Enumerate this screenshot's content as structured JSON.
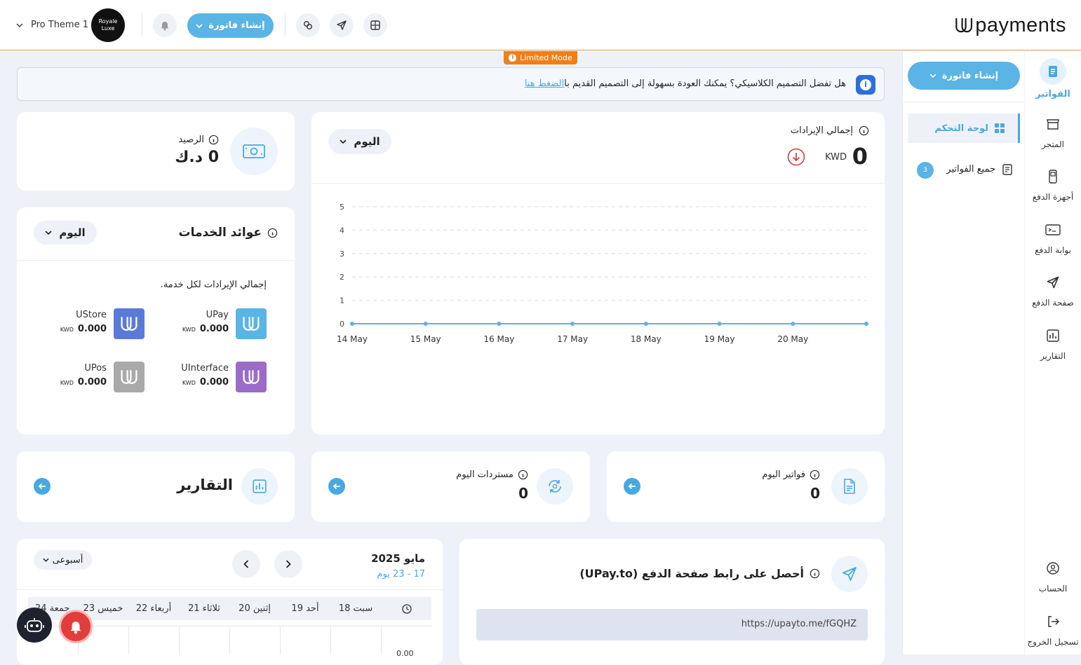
{
  "header": {
    "brand": "payments",
    "user_name": "Pro Theme 1",
    "avatar_text": [
      "Royale",
      "Luxe"
    ],
    "create_invoice_label": "إنشاء فاتورة"
  },
  "limited_mode": "Limited Mode",
  "banner": {
    "text": "هل تفضل التصميم الكلاسيكي؟ يمكنك العودة بسهولة إلى التصميم القديم با",
    "link": "الضغط هنا"
  },
  "rail": {
    "items": [
      {
        "label": "الفواتير",
        "icon": "invoice-icon",
        "active": true
      },
      {
        "label": "المتجر",
        "icon": "store-icon"
      },
      {
        "label": "أجهزة الدفع",
        "icon": "pos-device-icon"
      },
      {
        "label": "بوابة الدفع",
        "icon": "payment-gateway-icon"
      },
      {
        "label": "صفحة الدفع",
        "icon": "send-icon"
      },
      {
        "label": "التقارير",
        "icon": "reports-icon"
      }
    ],
    "account": "الحساب",
    "logout": "تسجيل الخروج"
  },
  "subpanel": {
    "create_invoice_label": "إنشاء فاتورة",
    "dashboard": "لوحة التحكم",
    "all_invoices": "جميع الفواتير",
    "all_invoices_count": "3"
  },
  "revenue": {
    "title": "إجمالي الإيرادات",
    "value": "0",
    "currency": "KWD",
    "period": "اليوم"
  },
  "chart_data": {
    "type": "line",
    "categories": [
      "14 May",
      "15 May",
      "16 May",
      "17 May",
      "18 May",
      "19 May",
      "20 May",
      ""
    ],
    "values": [
      0,
      0,
      0,
      0,
      0,
      0,
      0,
      0
    ],
    "y_ticks": [
      "0",
      "1",
      "2",
      "3",
      "4",
      "5"
    ],
    "ylim": [
      0,
      5
    ],
    "grid": true,
    "color": "#5ab4e5"
  },
  "balance": {
    "title": "الرصيد",
    "value": "0 د.ك"
  },
  "services": {
    "title": "عوائد الخدمات",
    "period": "اليوم",
    "subtitle": "إجمالي الإيرادات لكل خدمة.",
    "items": [
      {
        "name": "UPay",
        "value": "0.000",
        "unit": "KWD",
        "color": "#5ab4e5"
      },
      {
        "name": "UStore",
        "value": "0.000",
        "unit": "KWD",
        "color": "#5b7ad8"
      },
      {
        "name": "UInterface",
        "value": "0.000",
        "unit": "KWD",
        "color": "#9b6cc6"
      },
      {
        "name": "UPos",
        "value": "0.000",
        "unit": "KWD",
        "color": "#a9a9a9"
      }
    ]
  },
  "stats": {
    "invoices_today": {
      "title": "فواتير اليوم",
      "value": "0"
    },
    "refunds_today": {
      "title": "مستردات اليوم",
      "value": "0"
    },
    "reports": {
      "title": "التقارير"
    }
  },
  "payment_link": {
    "title": "أحصل على رابط صفحة الدفع (UPay.to)",
    "url": "https://upayto.me/fGQHZ"
  },
  "calendar": {
    "month": "مايو 2025",
    "range": "17 - 23 يوم",
    "view": "أسبوعى",
    "days": [
      "سبت 18",
      "أحد 19",
      "إثنين 20",
      "ثلاثاء 21",
      "أربعاء 22",
      "خميس 23",
      "جمعة 24"
    ],
    "first_cell": "0.00"
  }
}
